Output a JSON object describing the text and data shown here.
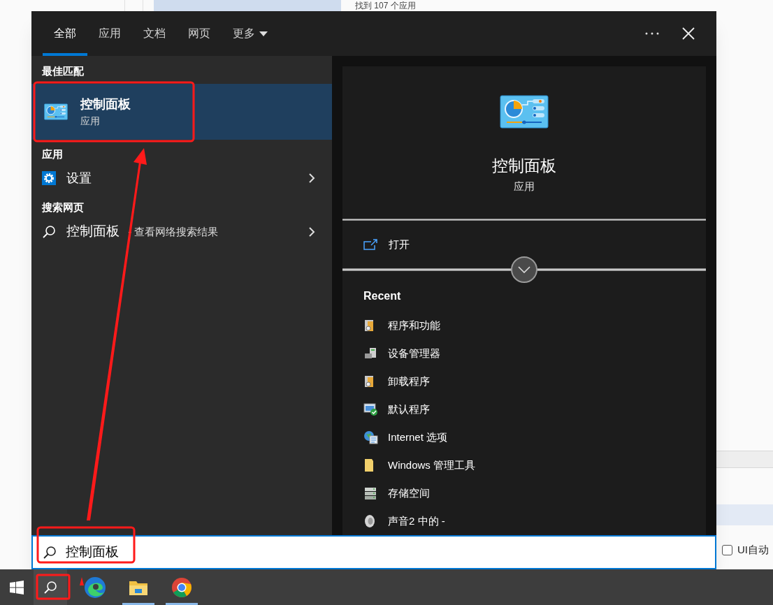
{
  "background": {
    "status_text": "找到 107 个应用",
    "checkbox": {
      "label": "UI自动",
      "checked": false
    }
  },
  "search_panel": {
    "tabs": [
      {
        "label": "全部",
        "selected": true,
        "kind": "tab"
      },
      {
        "label": "应用",
        "selected": false,
        "kind": "tab"
      },
      {
        "label": "文档",
        "selected": false,
        "kind": "tab"
      },
      {
        "label": "网页",
        "selected": false,
        "kind": "tab"
      },
      {
        "label": "更多",
        "selected": false,
        "kind": "dropdown"
      }
    ],
    "best_match": {
      "heading": "最佳匹配",
      "title": "控制面板",
      "subtitle": "应用",
      "selected": true
    },
    "sections": [
      {
        "heading": "应用",
        "items": [
          {
            "kind": "app",
            "label": "设置"
          }
        ]
      },
      {
        "heading": "搜索网页",
        "items": [
          {
            "kind": "web",
            "label": "控制面板",
            "detail": " - 查看网络搜索结果"
          }
        ]
      }
    ],
    "preview": {
      "title": "控制面板",
      "subtitle": "应用",
      "actions": [
        {
          "label": "打开"
        }
      ],
      "recent_heading": "Recent",
      "recent": [
        {
          "kind": "programs",
          "label": "程序和功能"
        },
        {
          "kind": "device",
          "label": "设备管理器"
        },
        {
          "kind": "programs",
          "label": "卸载程序"
        },
        {
          "kind": "default",
          "label": "默认程序"
        },
        {
          "kind": "internet",
          "label": "Internet 选项"
        },
        {
          "kind": "folder",
          "label": "Windows 管理工具"
        },
        {
          "kind": "storage",
          "label": "存储空间"
        },
        {
          "kind": "sound",
          "label": "声音2 中的 -"
        }
      ]
    },
    "search_field": {
      "value": "控制面板"
    }
  }
}
